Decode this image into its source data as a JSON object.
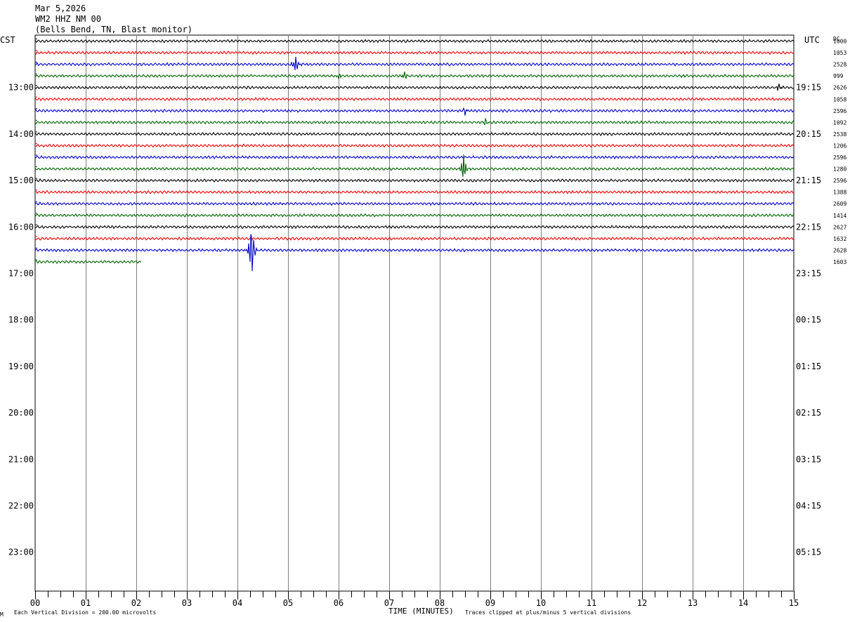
{
  "header": {
    "date": "Mar 5,2026",
    "station": "WM2 HHZ NM 00",
    "location": "(Bells Bend, TN, Blast monitor)"
  },
  "left_zone_label": "CST",
  "right_zone_label": "UTC",
  "dc_label": "DC",
  "footer": {
    "corner_mark": "M",
    "scale_note": "Each Vertical Division =  200.00 microvolts",
    "x_axis_title": "TIME (MINUTES)",
    "clip_note": "Traces clipped at plus/minus 5 vertical divisions"
  },
  "colors": {
    "cycle": [
      "#000000",
      "#ee0000",
      "#0000cc",
      "#006600"
    ],
    "grid": "#808080",
    "axis": "#000000"
  },
  "chart_data": {
    "type": "line",
    "title": "WM2 HHZ NM 00",
    "xlabel": "TIME (MINUTES)",
    "x_range": [
      0,
      15
    ],
    "x_ticks": [
      "00",
      "01",
      "02",
      "03",
      "04",
      "05",
      "06",
      "07",
      "08",
      "09",
      "10",
      "11",
      "12",
      "13",
      "14",
      "15"
    ],
    "rows_per_hour": 4,
    "left_hour_labels": [
      "13:00",
      "14:00",
      "15:00",
      "16:00",
      "17:00",
      "18:00",
      "19:00",
      "20:00",
      "21:00",
      "22:00",
      "23:00"
    ],
    "right_hour_labels": [
      "19:15",
      "20:15",
      "21:15",
      "22:15",
      "23:15",
      "00:15",
      "01:15",
      "02:15",
      "03:15",
      "04:15",
      "05:15"
    ],
    "traces": [
      {
        "dc": "1000",
        "end_minute": 15,
        "events": []
      },
      {
        "dc": "1053",
        "end_minute": 15,
        "events": []
      },
      {
        "dc": "2528",
        "end_minute": 15,
        "events": [
          {
            "minute": 5.15,
            "amplitude": 0.9
          }
        ]
      },
      {
        "dc": "999",
        "end_minute": 15,
        "events": [
          {
            "minute": 6.0,
            "amplitude": 0.3
          },
          {
            "minute": 7.3,
            "amplitude": 0.4
          }
        ]
      },
      {
        "dc": "2626",
        "end_minute": 15,
        "events": [
          {
            "minute": 14.7,
            "amplitude": 0.4
          }
        ]
      },
      {
        "dc": "1058",
        "end_minute": 15,
        "events": []
      },
      {
        "dc": "2596",
        "end_minute": 15,
        "events": [
          {
            "minute": 8.5,
            "amplitude": 0.35
          }
        ]
      },
      {
        "dc": "1092",
        "end_minute": 15,
        "events": [
          {
            "minute": 8.9,
            "amplitude": 0.35
          }
        ]
      },
      {
        "dc": "2538",
        "end_minute": 15,
        "events": []
      },
      {
        "dc": "1206",
        "end_minute": 15,
        "events": []
      },
      {
        "dc": "2596",
        "end_minute": 15,
        "events": []
      },
      {
        "dc": "1280",
        "end_minute": 15,
        "events": [
          {
            "minute": 8.47,
            "amplitude": 1.4
          }
        ]
      },
      {
        "dc": "2596",
        "end_minute": 15,
        "events": []
      },
      {
        "dc": "1388",
        "end_minute": 15,
        "events": []
      },
      {
        "dc": "2609",
        "end_minute": 15,
        "events": []
      },
      {
        "dc": "1414",
        "end_minute": 15,
        "events": []
      },
      {
        "dc": "2627",
        "end_minute": 15,
        "events": []
      },
      {
        "dc": "1632",
        "end_minute": 15,
        "events": []
      },
      {
        "dc": "2628",
        "end_minute": 15,
        "events": [
          {
            "minute": 4.28,
            "amplitude": 2.9
          }
        ]
      },
      {
        "dc": "1603",
        "end_minute": 2.1,
        "events": []
      }
    ]
  }
}
